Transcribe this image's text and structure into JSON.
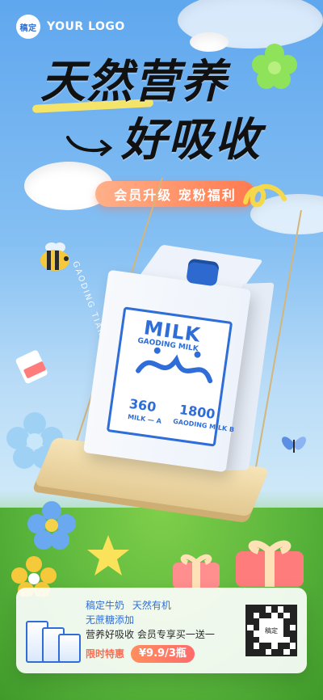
{
  "logo": {
    "badge": "稿定",
    "text": "YOUR LOGO"
  },
  "headline": {
    "line1": "天然营养",
    "line2": "好吸收"
  },
  "pill": "会员升级 宠粉福利",
  "vertical_text": {
    "left": "GAODING TIANRANYINGYANG"
  },
  "carton": {
    "brand": "MILK",
    "sub": "GAODING MILK",
    "num1": "360",
    "num2": "1800",
    "unit1": "MILK — A",
    "unit2": "GAODING MILK B"
  },
  "card": {
    "line1a": "稿定牛奶",
    "line1b": "天然有机",
    "line2": "无蔗糖添加",
    "line3": "营养好吸收 会员专享买一送一",
    "limited": "限时特惠",
    "price": "¥9.9/3瓶",
    "qr_label": "稿定"
  }
}
